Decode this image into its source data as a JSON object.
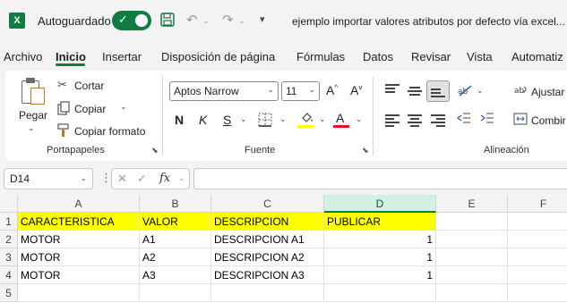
{
  "titlebar": {
    "app_letter": "X",
    "autosave_label": "Autoguardado",
    "autosave_on": true,
    "doc_title": "ejemplo importar valores atributos por defecto vía excel..."
  },
  "tabs": [
    "Archivo",
    "Inicio",
    "Insertar",
    "Disposición de página",
    "Fórmulas",
    "Datos",
    "Revisar",
    "Vista",
    "Automatiz"
  ],
  "active_tab": "Inicio",
  "ribbon": {
    "clipboard": {
      "paste": "Pegar",
      "cut": "Cortar",
      "copy": "Copiar",
      "format_painter": "Copiar formato",
      "group": "Portapapeles"
    },
    "font": {
      "name": "Aptos Narrow",
      "size": "11",
      "bold": "N",
      "italic": "K",
      "underline": "S",
      "font_color_letter": "A",
      "grow": "A",
      "shrink": "A",
      "group": "Fuente"
    },
    "alignment": {
      "wrap": "Ajustar",
      "merge": "Combir",
      "group": "Alineación"
    }
  },
  "formula_bar": {
    "name_box": "D14",
    "fx": "fx",
    "value": ""
  },
  "sheet": {
    "columns": [
      "A",
      "B",
      "C",
      "D",
      "E",
      "F"
    ],
    "selected_column": "D",
    "rows": [
      "1",
      "2",
      "3",
      "4",
      "5"
    ],
    "cells": [
      [
        "CARACTERISTICA",
        "VALOR",
        "DESCRIPCION",
        "PUBLICAR",
        "",
        ""
      ],
      [
        "MOTOR",
        "A1",
        "DESCRIPCION A1",
        "1",
        "",
        ""
      ],
      [
        "MOTOR",
        "A2",
        "DESCRIPCION A2",
        "1",
        "",
        ""
      ],
      [
        "MOTOR",
        "A3",
        "DESCRIPCION A3",
        "1",
        "",
        ""
      ],
      [
        "",
        "",
        "",
        "",
        "",
        ""
      ]
    ],
    "header_fill": "#ffff00"
  },
  "colors": {
    "accent": "#107c41",
    "highlight_yellow": "#ffff00",
    "font_red": "#e81123"
  }
}
